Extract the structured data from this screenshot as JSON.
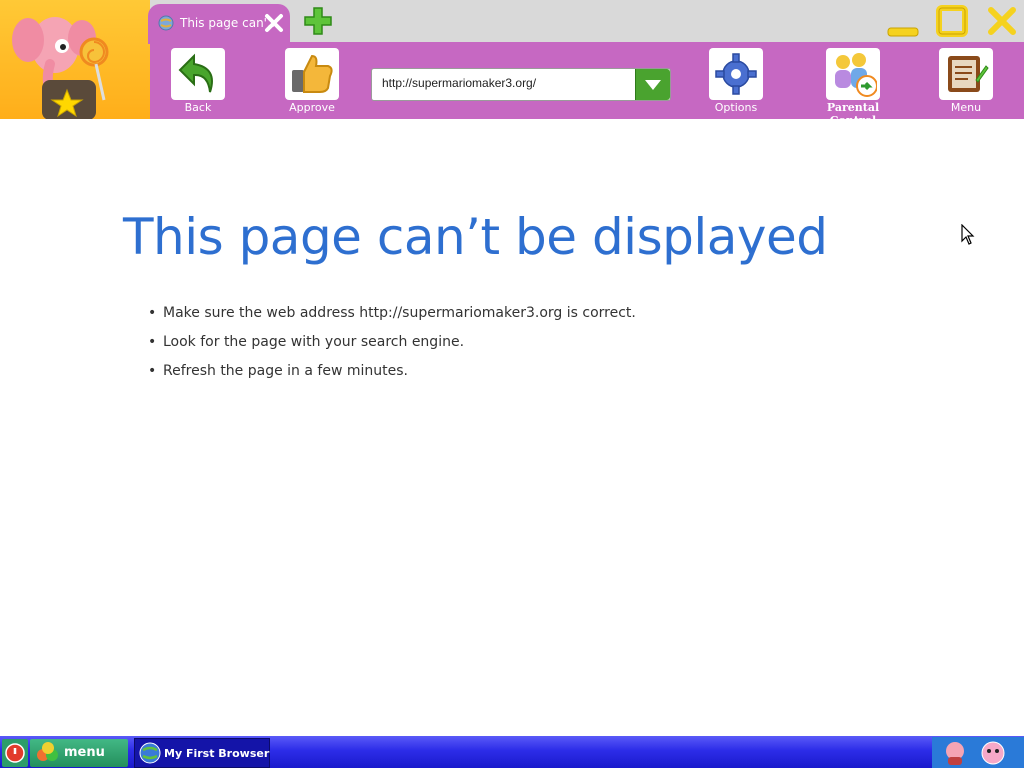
{
  "tab": {
    "title": "This page can'…"
  },
  "toolbar": {
    "back_label": "Back",
    "approve_label": "Approve",
    "options_label": "Options",
    "parental_label": "Parental Control",
    "menu_label": "Menu"
  },
  "address_bar": {
    "url": "http://supermariomaker3.org/"
  },
  "error_page": {
    "title": "This page can’t be displayed",
    "bullets": [
      "Make sure the web address http://supermariomaker3.org is correct.",
      "Look for the page with your search engine.",
      "Refresh the page in a few minutes."
    ]
  },
  "taskbar": {
    "menu_label": "menu",
    "app_label": "My First Browser"
  },
  "icons": {
    "tab_close": "close-icon",
    "new_tab": "plus-icon",
    "back": "back-arrow-icon",
    "approve": "thumbs-up-icon",
    "options": "gear-icon",
    "parental": "parental-control-icon",
    "menu": "notebook-pencil-icon"
  },
  "colors": {
    "chrome_purple": "#c668c2",
    "title_blue": "#2e6fd0",
    "taskbar_blue": "#2c2ce8",
    "green_accent": "#4aa32f",
    "window_buttons_yellow": "#f5d21f"
  }
}
